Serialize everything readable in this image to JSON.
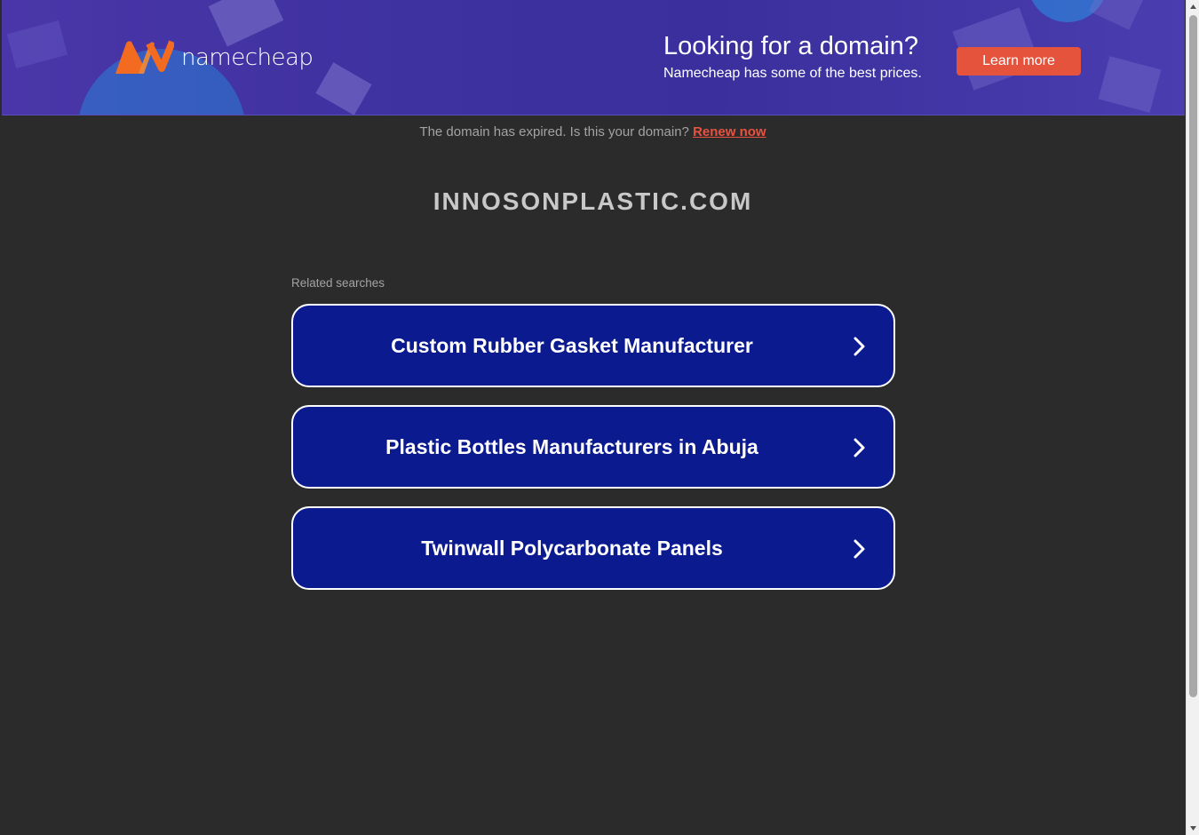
{
  "banner": {
    "brand": "namecheap",
    "promo_title": "Looking for a domain?",
    "promo_subtitle": "Namecheap has some of the best prices.",
    "cta_label": "Learn more",
    "colors": {
      "background": "#3e31a0",
      "cta": "#e5533d",
      "logo_orange": "#f26b21"
    }
  },
  "notice": {
    "text": "The domain has expired. Is this your domain?",
    "link_label": "Renew now",
    "link_color": "#e9523f"
  },
  "domain_name": "INNOSONPLASTIC.COM",
  "related": {
    "label": "Related searches",
    "items": [
      {
        "label": "Custom Rubber Gasket Manufacturer",
        "icon": "chevron-right-icon"
      },
      {
        "label": "Plastic Bottles Manufacturers in Abuja",
        "icon": "chevron-right-icon"
      },
      {
        "label": "Twinwall Polycarbonate Panels",
        "icon": "chevron-right-icon"
      }
    ],
    "button_color": "#0b1a8f"
  },
  "page_background": "#2b2b2b"
}
